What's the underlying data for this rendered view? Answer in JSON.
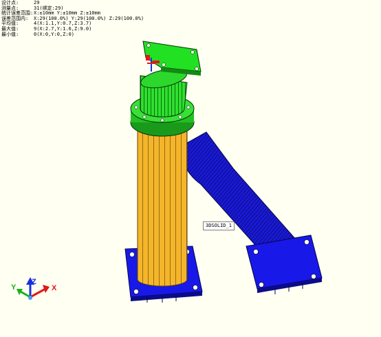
{
  "stats": [
    {
      "label": "设计点:",
      "value": "29"
    },
    {
      "label": "测量点:",
      "value": "31(绑定:29)"
    },
    {
      "label": "统计误差范围:",
      "value": "X:±10mm Y:±10mm Z:±10mm"
    },
    {
      "label": "误差范围内:",
      "value": "X:29(100.0%) Y:29(100.0%) Z:29(100.0%)"
    },
    {
      "label": "平均值:",
      "value": "4(X:1.1,Y:0.7,Z:3.7)"
    },
    {
      "label": "最大值:",
      "value": "9(X:2.7,Y:1.6,Z:9.0)"
    },
    {
      "label": "最小值:",
      "value": "0(X:0,Y:0,Z:0)"
    }
  ],
  "model_tag": "3DSOLID_1",
  "axes": {
    "x": "X",
    "y": "Y",
    "z": "Z"
  },
  "colors": {
    "background": "#fffff2",
    "flange_green": "#22e022",
    "column_yellow": "#f5b52a",
    "pipe_blue": "#1414d8",
    "axis_x": "#e01818",
    "axis_y": "#18b018",
    "axis_z": "#1830e0"
  }
}
